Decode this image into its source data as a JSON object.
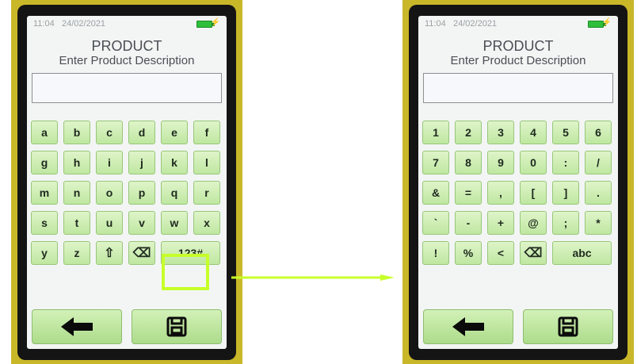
{
  "screens": [
    {
      "status": {
        "time": "11:04",
        "date": "24/02/2021"
      },
      "title": "PRODUCT",
      "subtitle": "Enter Product Description",
      "description_field": {
        "value": ""
      },
      "keyboard_rows": [
        [
          "a",
          "b",
          "c",
          "d",
          "e",
          "f"
        ],
        [
          "g",
          "h",
          "i",
          "j",
          "k",
          "l"
        ],
        [
          "m",
          "n",
          "o",
          "p",
          "q",
          "r"
        ],
        [
          "s",
          "t",
          "u",
          "v",
          "w",
          "x"
        ],
        [
          "y",
          "z",
          "⇧",
          "⌫",
          "123#"
        ]
      ],
      "bottom_buttons": [
        "back",
        "save"
      ]
    },
    {
      "status": {
        "time": "11:04",
        "date": "24/02/2021"
      },
      "title": "PRODUCT",
      "subtitle": "Enter Product Description",
      "description_field": {
        "value": ""
      },
      "keyboard_rows": [
        [
          "1",
          "2",
          "3",
          "4",
          "5",
          "6"
        ],
        [
          "7",
          "8",
          "9",
          "0",
          ":",
          "/"
        ],
        [
          "&",
          "=",
          ",",
          "[",
          "]",
          "."
        ],
        [
          "`",
          "-",
          "+",
          "@",
          ";",
          "*"
        ],
        [
          "!",
          "%",
          "<",
          "⌫",
          "abc"
        ]
      ],
      "bottom_buttons": [
        "back",
        "save"
      ]
    }
  ],
  "icons": {
    "shift": "shift-icon",
    "backspace": "backspace-icon",
    "back": "arrow-left-icon",
    "save": "floppy-disk-icon",
    "battery": "battery-icon"
  },
  "colors": {
    "device_bezel": "#141414",
    "screen_bg": "#f3f5f4",
    "key_bg": "#c8ebad",
    "highlight": "#c7ff2a",
    "battery": "#2fbf3b"
  }
}
